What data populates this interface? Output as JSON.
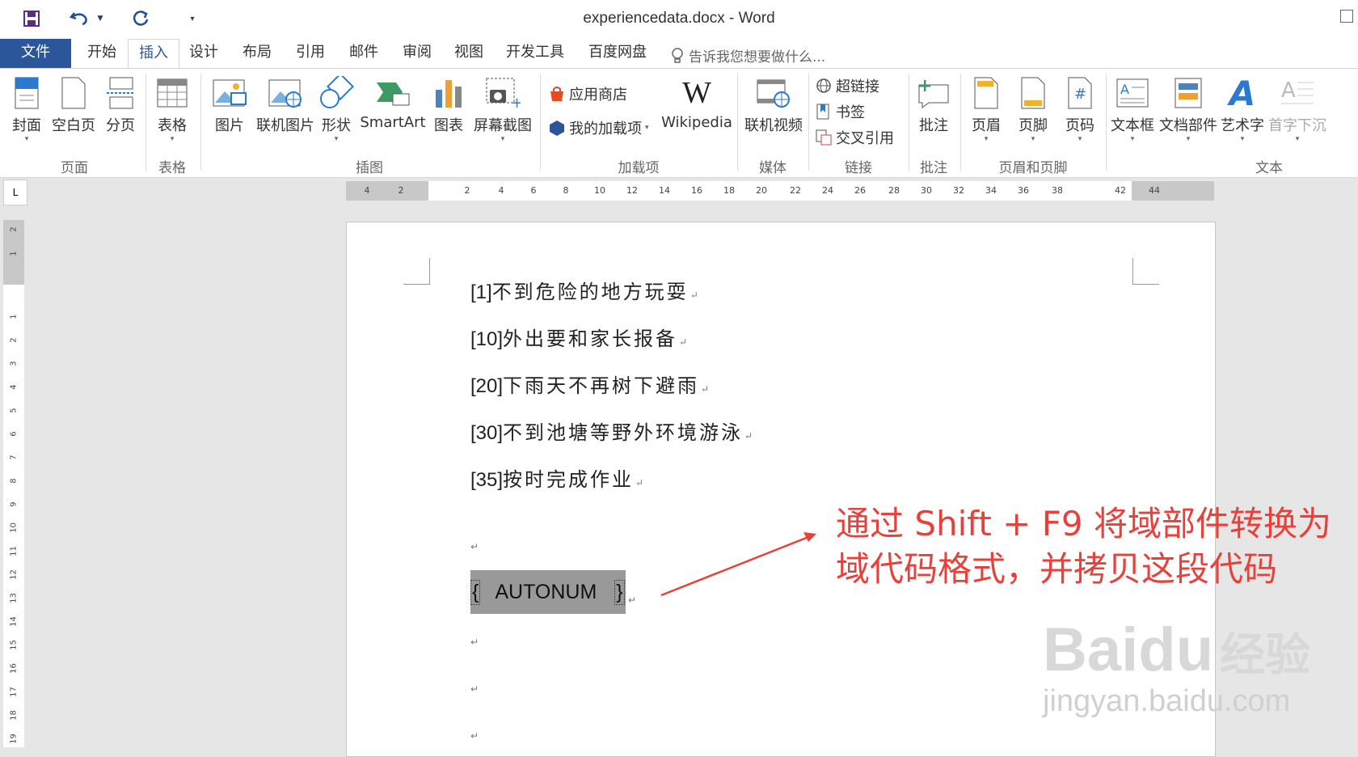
{
  "window": {
    "title": "experiencedata.docx - Word"
  },
  "tabs": [
    {
      "label": "文件"
    },
    {
      "label": "开始"
    },
    {
      "label": "插入"
    },
    {
      "label": "设计"
    },
    {
      "label": "布局"
    },
    {
      "label": "引用"
    },
    {
      "label": "邮件"
    },
    {
      "label": "审阅"
    },
    {
      "label": "视图"
    },
    {
      "label": "开发工具"
    },
    {
      "label": "百度网盘"
    }
  ],
  "active_tab": "插入",
  "tell_me": "告诉我您想要做什么...",
  "ribbon": {
    "pages": {
      "cover": "封面",
      "blank": "空白页",
      "break": "分页",
      "group": "页面"
    },
    "tables": {
      "table": "表格",
      "group": "表格"
    },
    "illustrations": {
      "picture": "图片",
      "online_picture": "联机图片",
      "shapes": "形状",
      "smartart": "SmartArt",
      "chart": "图表",
      "screenshot": "屏幕截图",
      "group": "插图"
    },
    "addins": {
      "store": "应用商店",
      "my_addins": "我的加载项",
      "wikipedia": "Wikipedia",
      "group": "加载项"
    },
    "media": {
      "online_video": "联机视频",
      "group": "媒体"
    },
    "links": {
      "hyperlink": "超链接",
      "bookmark": "书签",
      "crossref": "交叉引用",
      "group": "链接"
    },
    "comments": {
      "comment": "批注",
      "group": "批注"
    },
    "header_footer": {
      "header": "页眉",
      "footer": "页脚",
      "page_number": "页码",
      "group": "页眉和页脚"
    },
    "text": {
      "textbox": "文本框",
      "quickparts": "文档部件",
      "wordart": "艺术字",
      "dropcap": "首字下沉",
      "group": "文本"
    }
  },
  "ruler_h": [
    "4",
    "2",
    "2",
    "4",
    "6",
    "8",
    "10",
    "12",
    "14",
    "16",
    "18",
    "20",
    "22",
    "24",
    "26",
    "28",
    "30",
    "32",
    "34",
    "36",
    "38",
    "42",
    "44"
  ],
  "ruler_v": [
    "2",
    "1",
    "1",
    "2",
    "3",
    "4",
    "5",
    "6",
    "7",
    "8",
    "9",
    "10",
    "11",
    "12",
    "13",
    "14",
    "15",
    "16",
    "17",
    "18",
    "19"
  ],
  "document": {
    "paragraphs": [
      {
        "num": "[1]",
        "text": "不到危险的地方玩耍"
      },
      {
        "num": "[10]",
        "text": "外出要和家长报备"
      },
      {
        "num": "[20]",
        "text": "下雨天不再树下避雨"
      },
      {
        "num": "[30]",
        "text": "不到池塘等野外环境游泳"
      },
      {
        "num": "[35]",
        "text": "按时完成作业"
      }
    ],
    "paragraph_mark": "↵",
    "field_open": "{",
    "field_code": "AUTONUM",
    "field_close": "}"
  },
  "annotation": {
    "line1": "通过 Shift + F9 将域部件转换为",
    "line2": "域代码格式，并拷贝这段代码",
    "color": "#e8403a"
  },
  "watermark": {
    "brand": "Bai",
    "brand2": "du",
    "cn": "经验",
    "url": "jingyan.baidu.com"
  }
}
